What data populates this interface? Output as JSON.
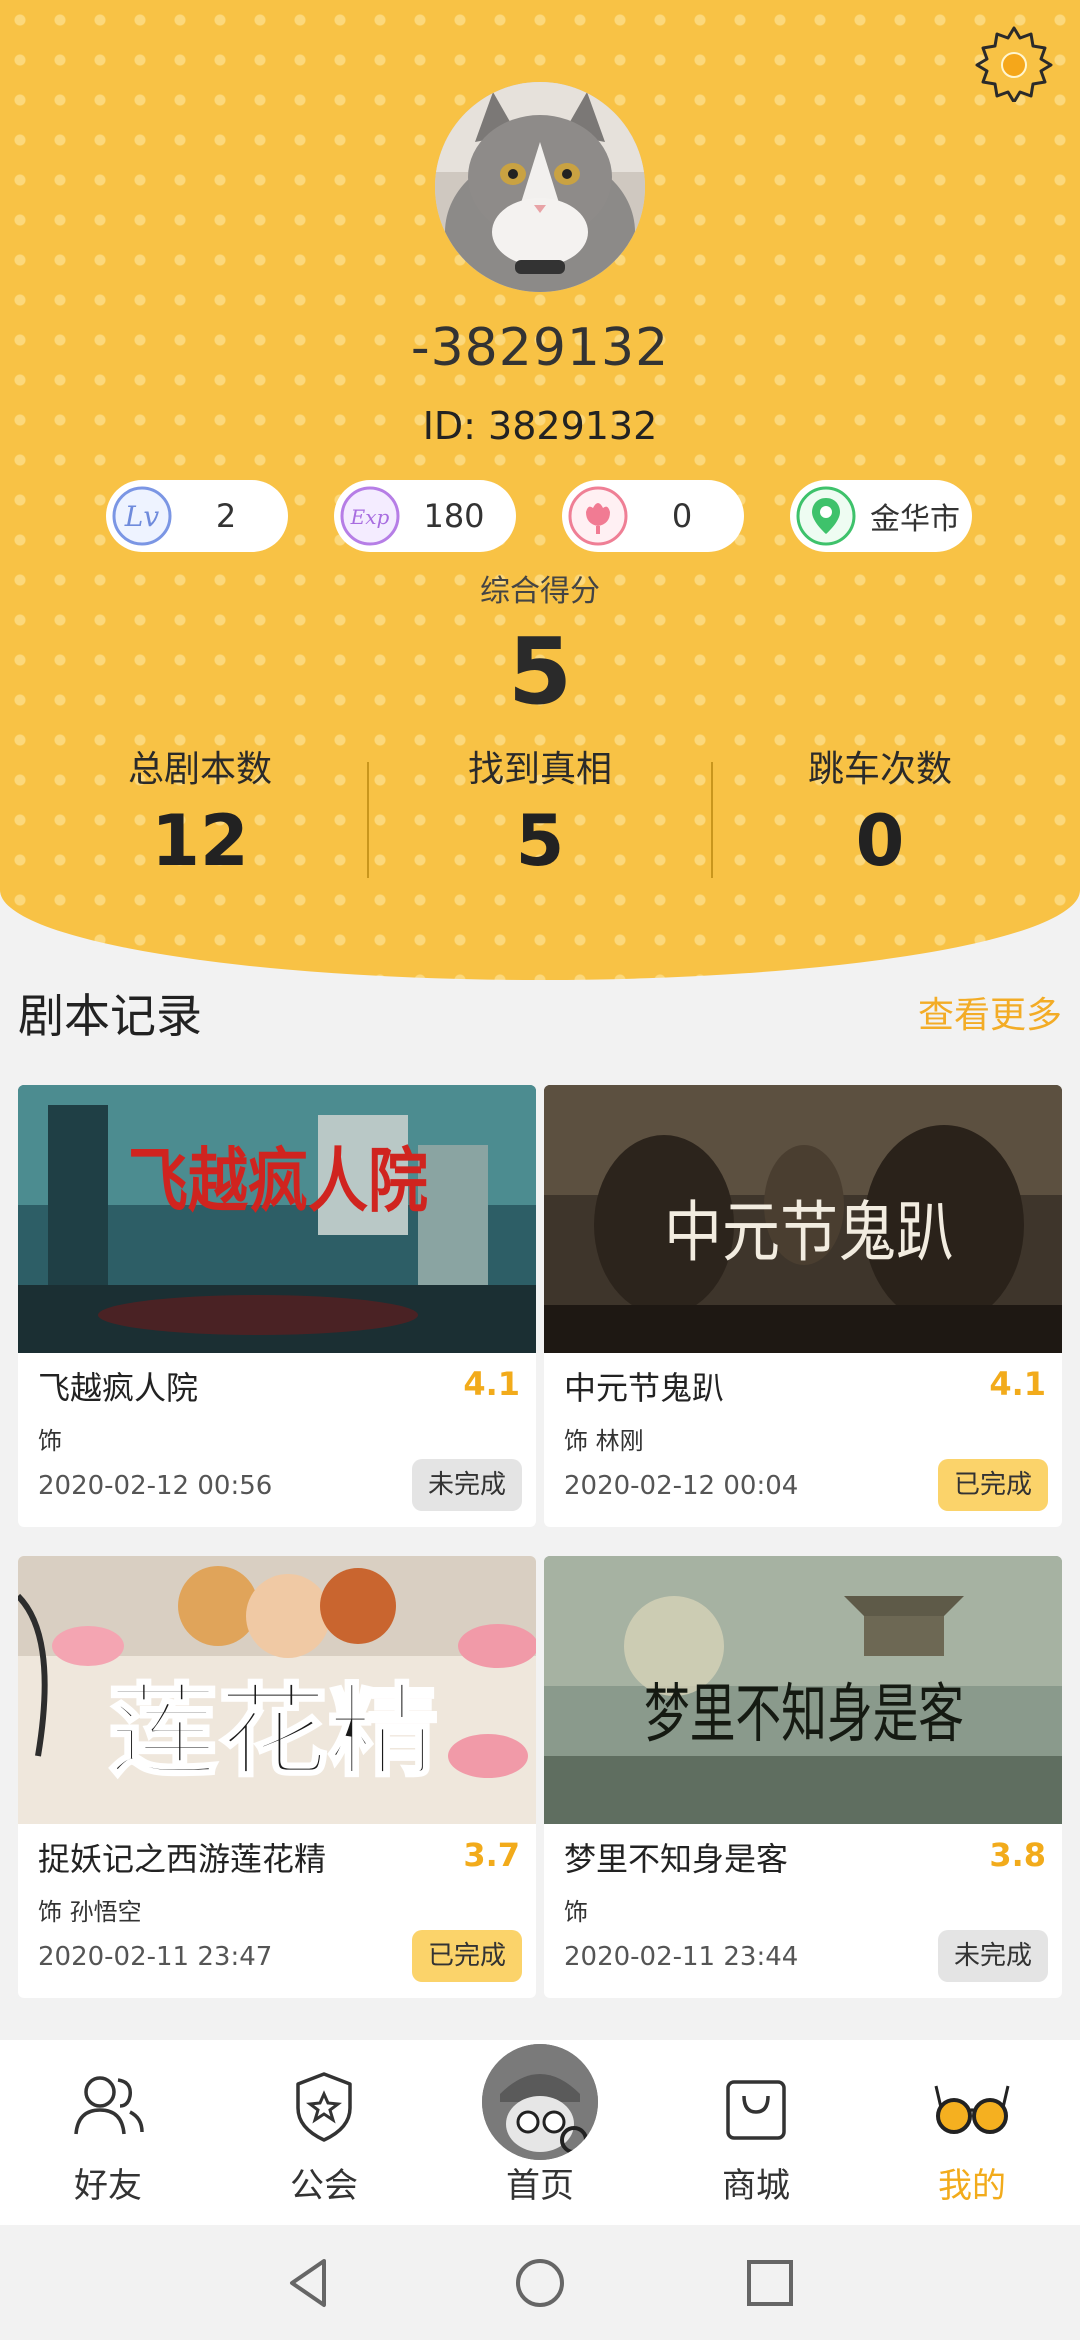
{
  "profile": {
    "username": "-3829132",
    "user_id": "ID: 3829132",
    "pills": [
      {
        "icon": "level-icon",
        "value": "2"
      },
      {
        "icon": "exp-icon",
        "value": "180"
      },
      {
        "icon": "flower-icon",
        "value": "0"
      },
      {
        "icon": "location-pin-icon",
        "value": "金华市"
      }
    ],
    "score_label": "综合得分",
    "score_value": "5",
    "stats": [
      {
        "label": "总剧本数",
        "value": "12"
      },
      {
        "label": "找到真相",
        "value": "5"
      },
      {
        "label": "跳车次数",
        "value": "0"
      }
    ]
  },
  "records": {
    "title": "剧本记录",
    "more_label": "查看更多",
    "items": [
      {
        "title": "飞越疯人院",
        "score": "4.1",
        "role": "饰",
        "date": "2020-02-12   00:56",
        "status": "未完成",
        "cover_text": "飞越疯人院"
      },
      {
        "title": "中元节鬼趴",
        "score": "4.1",
        "role": "饰 林刚",
        "date": "2020-02-12   00:04",
        "status": "已完成",
        "cover_text": "中元节鬼趴"
      },
      {
        "title": "捉妖记之西游莲花精",
        "score": "3.7",
        "role": "饰 孙悟空",
        "date": "2020-02-11   23:47",
        "status": "已完成",
        "cover_text": "莲花精"
      },
      {
        "title": "梦里不知身是客",
        "score": "3.8",
        "role": "饰",
        "date": "2020-02-11   23:44",
        "status": "未完成",
        "cover_text": "梦里不知身是客"
      }
    ]
  },
  "nav": {
    "items": [
      {
        "label": "好友",
        "icon": "friends-icon"
      },
      {
        "label": "公会",
        "icon": "guild-shield-icon"
      },
      {
        "label": "首页",
        "icon": "home-detective-icon"
      },
      {
        "label": "商城",
        "icon": "shopping-bag-icon"
      },
      {
        "label": "我的",
        "icon": "glasses-icon",
        "active": true
      }
    ]
  },
  "colors": {
    "header_bg": "#f8c245",
    "accent": "#f2ab1b",
    "status_done": "#fbd36a",
    "status_undone": "#e4e4e4"
  }
}
